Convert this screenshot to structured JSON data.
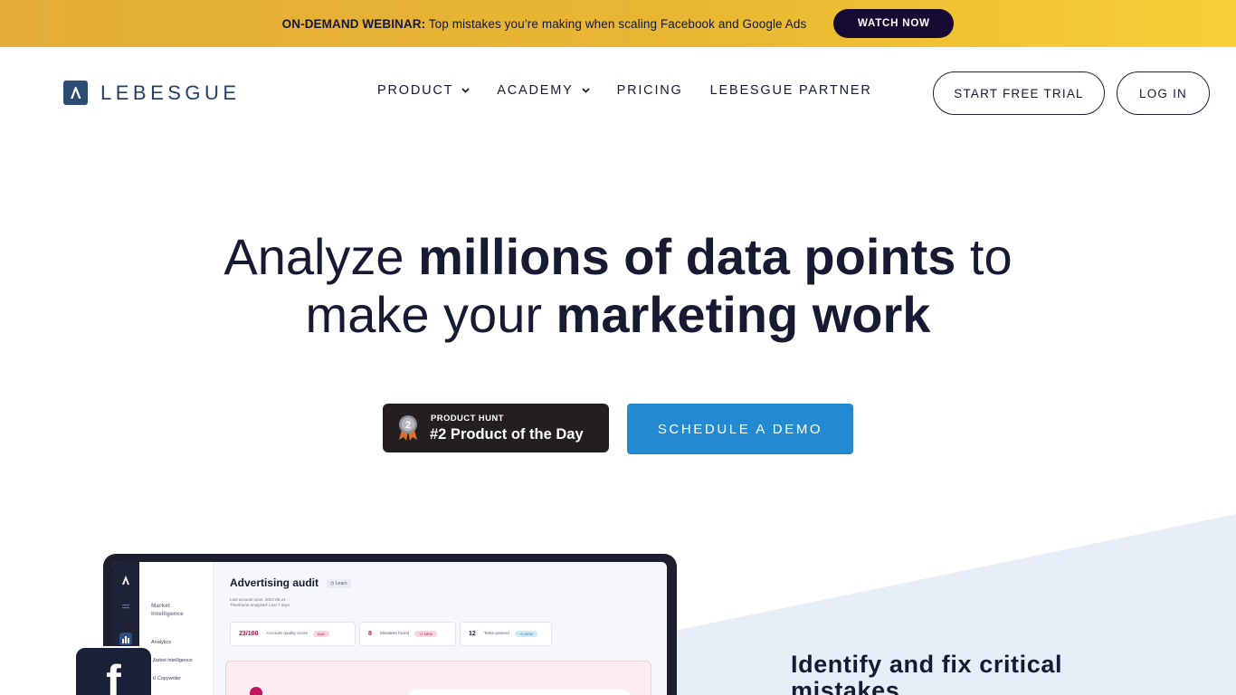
{
  "banner": {
    "label": "ON-DEMAND WEBINAR:",
    "text": " Top mistakes you’re making when scaling Facebook and Google Ads",
    "button": "WATCH NOW"
  },
  "header": {
    "logo_text": "LEBESGUE",
    "nav": [
      {
        "label": "PRODUCT",
        "has_dropdown": true
      },
      {
        "label": "ACADEMY",
        "has_dropdown": true
      },
      {
        "label": "PRICING",
        "has_dropdown": false
      },
      {
        "label": "LEBESGUE PARTNER",
        "has_dropdown": false
      }
    ],
    "trial_button": "START FREE TRIAL",
    "login_button": "LOG IN"
  },
  "hero": {
    "line1_a": "Analyze ",
    "line1_b": "millions of data points",
    "line1_c": " to",
    "line2_a": "make your ",
    "line2_b": "marketing work",
    "product_hunt_small": "PRODUCT HUNT",
    "product_hunt_big": "#2 Product of the Day",
    "medal_number": "2",
    "demo_button": "SCHEDULE A DEMO"
  },
  "app_preview": {
    "title": "Advertising audit",
    "learn": "◷ Learn",
    "meta_1": "Last account scan: 2022-06-21",
    "meta_2": "Timeframe analyzed: Last 7 days",
    "sidebar_title_1": "Market",
    "sidebar_title_2": "Intelligence",
    "sidebar_items": [
      "Analytics",
      "Market intelligence",
      "AI Copywriter"
    ],
    "cards": [
      {
        "value": "23/100",
        "label": "Account quality score",
        "tag": "BAD"
      },
      {
        "value": "8",
        "label": "Mistakes found",
        "tag": "+1 NEW"
      },
      {
        "value": "12",
        "label": "Tests passed",
        "tag": "+3 NEW"
      }
    ],
    "fb_icon": "f"
  },
  "feature": {
    "heading": "Identify and fix critical mistakes"
  },
  "colors": {
    "banner_gradient_start": "#e3ad37",
    "banner_gradient_end": "#f7cf36",
    "banner_button": "#180b33",
    "demo_button": "#2389d1",
    "logo": "#25406a",
    "text_dark": "#151a33",
    "bad_accent": "#b0154e",
    "wedge": "#e8eef8"
  },
  "icons": {
    "logo": "lebesgue-logo-icon",
    "nav_dropdown": "chevron-down-icon",
    "medal": "medal-icon",
    "facebook": "facebook-icon"
  }
}
